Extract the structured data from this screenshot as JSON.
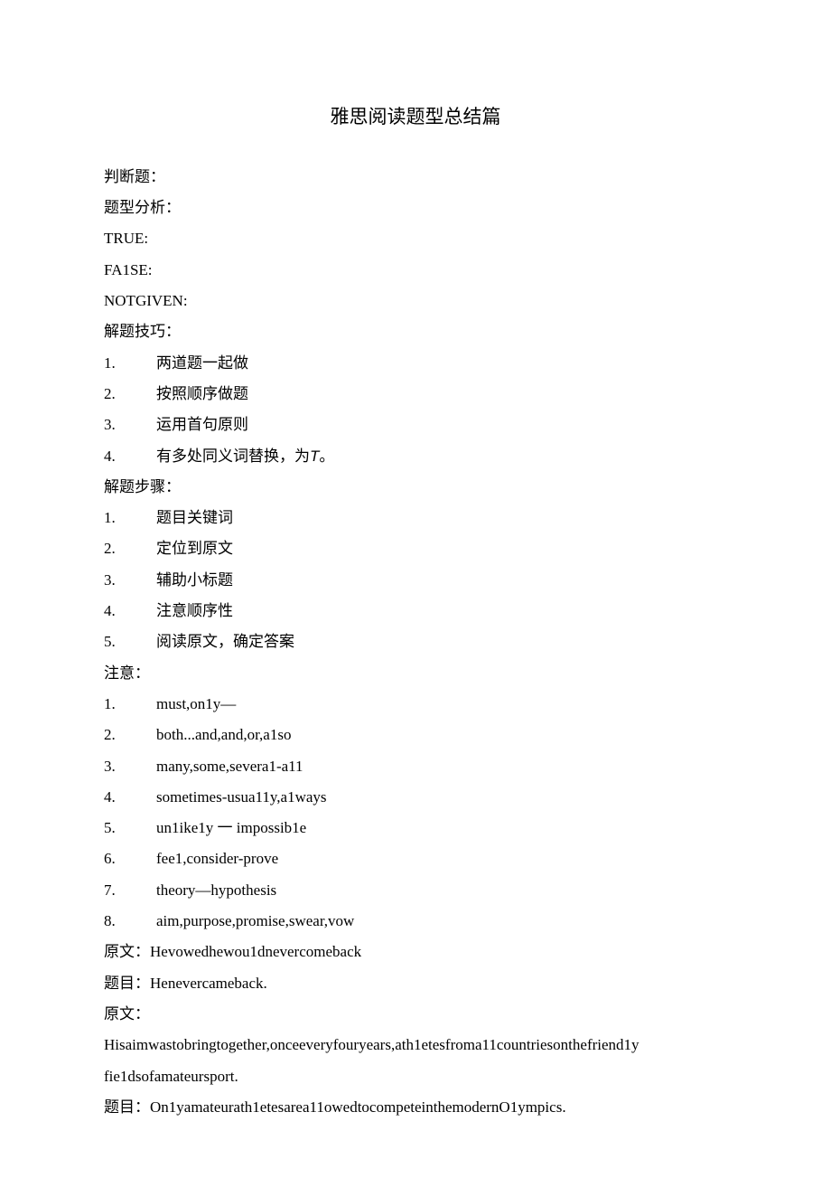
{
  "title": "雅思阅读题型总结篇",
  "sections": {
    "judge_label": "判断题：",
    "type_analysis": "题型分析：",
    "true_label": "TRUE:",
    "false_label": "FA1SE:",
    "notgiven_label": "NOTGIVEN:",
    "skills_label": "解题技巧：",
    "skills": [
      {
        "num": "1.",
        "text": "两道题一起做"
      },
      {
        "num": "2.",
        "text": "按照顺序做题"
      },
      {
        "num": "3.",
        "text": "运用首句原则"
      },
      {
        "num": "4.",
        "text_pre": "有多处同义词替换，为",
        "text_t": "T",
        "text_post": "。"
      }
    ],
    "steps_label": "解题步骤：",
    "steps": [
      {
        "num": "1.",
        "text": "题目关键词"
      },
      {
        "num": "2.",
        "text": "定位到原文"
      },
      {
        "num": "3.",
        "text": "辅助小标题"
      },
      {
        "num": "4.",
        "text": "注意顺序性"
      },
      {
        "num": "5.",
        "text": "阅读原文，确定答案"
      }
    ],
    "notes_label": "注意：",
    "notes": [
      {
        "num": "1.",
        "text": "must,on1y—"
      },
      {
        "num": "2.",
        "text": "both...and,and,or,a1so"
      },
      {
        "num": "3.",
        "text": "many,some,severa1-a11"
      },
      {
        "num": "4.",
        "text": "sometimes-usua11y,a1ways"
      },
      {
        "num": "5.",
        "text": "un1ike1y 一 impossib1e"
      },
      {
        "num": "6.",
        "text": "fee1,consider-prove"
      },
      {
        "num": "7.",
        "text": "theory—hypothesis"
      },
      {
        "num": "8.",
        "text": "aim,purpose,promise,swear,vow"
      }
    ],
    "example1_source": "原文：Hevowedhewou1dnevercomeback",
    "example1_question": "题目：Henevercameback.",
    "example2_source_label": "原文：",
    "example2_source_line1": "Hisaimwastobringtogether,onceeveryfouryears,ath1etesfroma11countriesonthefriend1y",
    "example2_source_line2": "fie1dsofamateursport.",
    "example2_question": "题目：On1yamateurath1etesarea11owedtocompeteinthemodernO1ympics."
  }
}
